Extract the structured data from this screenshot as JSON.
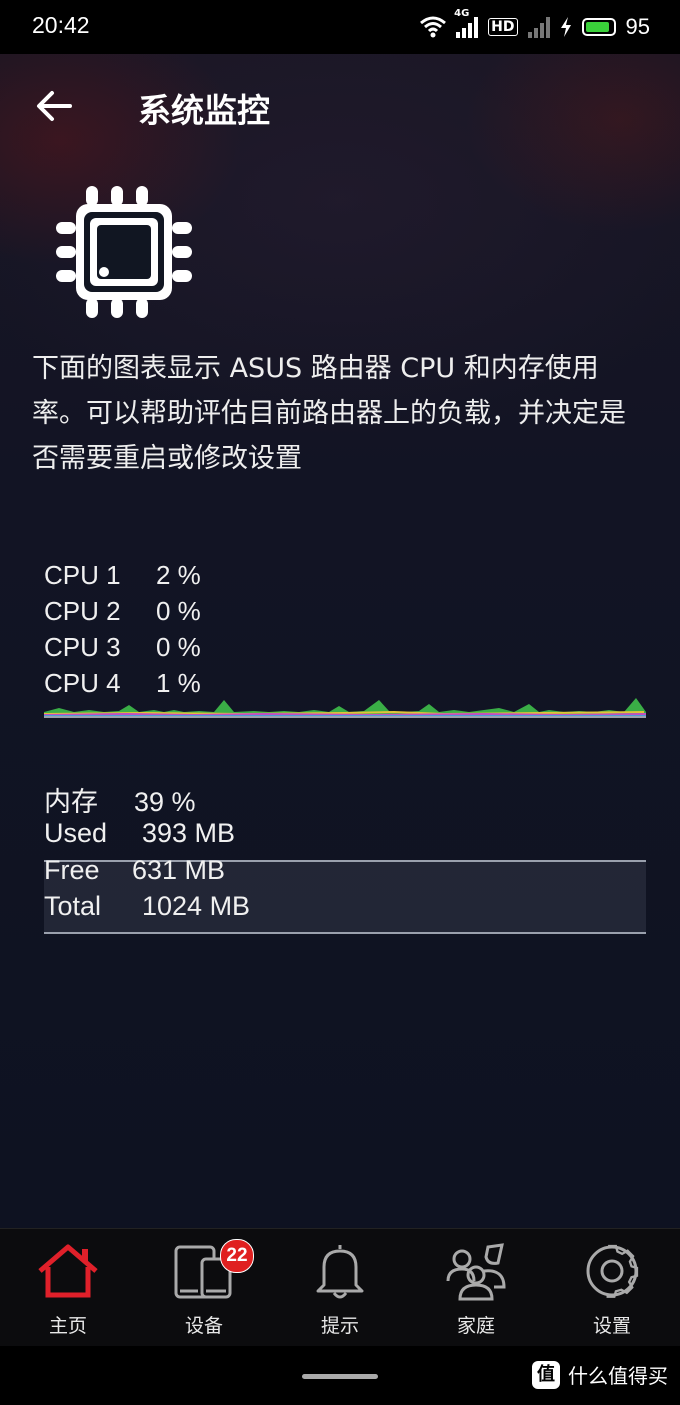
{
  "status_bar": {
    "time": "20:42",
    "network_label": "4G",
    "hd_label": "HD",
    "battery_percent": "95",
    "battery_level": 0.95,
    "icons": [
      "wifi-icon",
      "signal-icon",
      "hd-icon",
      "signal-weak-icon",
      "charging-icon",
      "battery-icon"
    ]
  },
  "header": {
    "title": "系统监控",
    "back_icon": "arrow-left-icon"
  },
  "hero_icon": "cpu-chip-icon",
  "description": "下面的图表显示 ASUS 路由器 CPU 和内存使用率。可以帮助评估目前路由器上的负载，并决定是否需要重启或修改设置",
  "cpu": {
    "rows": [
      {
        "label": "CPU 1",
        "value": "2 %"
      },
      {
        "label": "CPU 2",
        "value": "0 %"
      },
      {
        "label": "CPU 3",
        "value": "0 %"
      },
      {
        "label": "CPU 4",
        "value": "1 %"
      }
    ],
    "chart_colors": {
      "cpu1": "#3fbf4a",
      "cpu2": "#e0c43a",
      "cpu3": "#4a9ad8",
      "cpu4": "#c050c0"
    }
  },
  "memory": {
    "usage_label": "内存",
    "usage_value": "39 %",
    "usage_fraction": 0.39,
    "used_label": "Used",
    "used_value": "393 MB",
    "free_label": "Free",
    "free_value": "631 MB",
    "total_label": "Total",
    "total_value": "1024 MB"
  },
  "tabbar": {
    "accent_color": "#e0202a",
    "tabs": [
      {
        "label": "主页",
        "icon": "home-icon",
        "active": true
      },
      {
        "label": "设备",
        "icon": "devices-icon",
        "badge": "22"
      },
      {
        "label": "提示",
        "icon": "bell-icon"
      },
      {
        "label": "家庭",
        "icon": "family-icon"
      },
      {
        "label": "设置",
        "icon": "gear-icon"
      }
    ]
  },
  "watermark": {
    "logo": "值",
    "text": "什么值得买"
  }
}
